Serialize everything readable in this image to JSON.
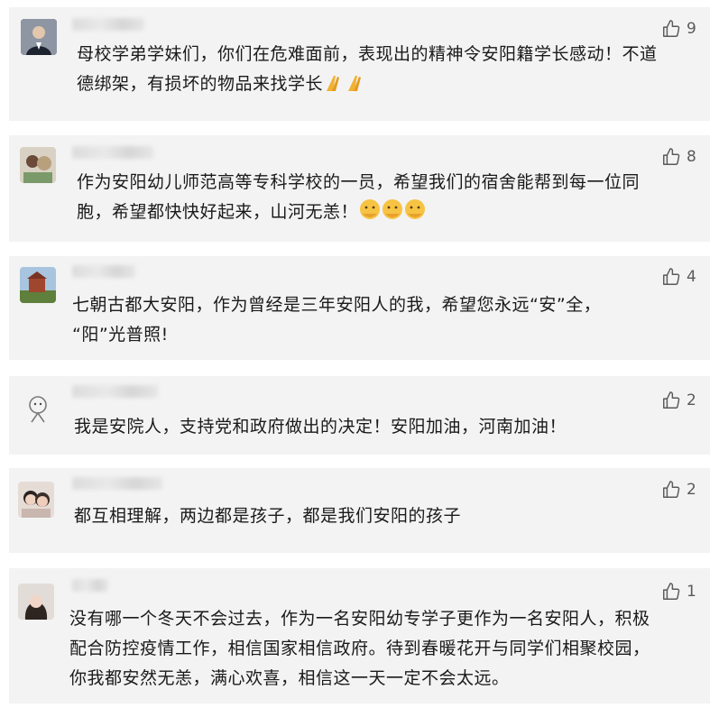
{
  "comments": [
    {
      "likes": "9",
      "lines": [
        "母校学弟学妹们，你们在危难面前，表现出的精神令安阳籍学长感动！不道",
        "德绑架，有损坏的物品来找学长"
      ],
      "emoji": "🙏🙏"
    },
    {
      "likes": "8",
      "lines": [
        "作为安阳幼儿师范高等专科学校的一员，希望我们的宿舍能帮到每一位同",
        "胞，希望都快快好起来，山河无恙！"
      ],
      "emoji": "🤝🤝🤝"
    },
    {
      "likes": "4",
      "lines": [
        "七朝古都大安阳，作为曾经是三年安阳人的我，希望您永远“安”全，",
        "“阳”光普照!"
      ],
      "emoji": ""
    },
    {
      "likes": "2",
      "lines": [
        "我是安院人，支持党和政府做出的决定！安阳加油，河南加油！"
      ],
      "emoji": ""
    },
    {
      "likes": "2",
      "lines": [
        "都互相理解，两边都是孩子，都是我们安阳的孩子"
      ],
      "emoji": ""
    },
    {
      "likes": "1",
      "lines": [
        "没有哪一个冬天不会过去，作为一名安阳幼专学子更作为一名安阳人，积极",
        "配合防控疫情工作，相信国家相信政府。待到春暖花开与同学们相聚校园，",
        "你我都安然无恙，满心欢喜，相信这一天一定不会太远。"
      ],
      "emoji": ""
    }
  ],
  "icons": {
    "like": "thumbs-up-icon"
  },
  "colors": {
    "card_bg": "#f3f3f3",
    "text": "#1a1a1a",
    "like": "#5a5a5a"
  }
}
